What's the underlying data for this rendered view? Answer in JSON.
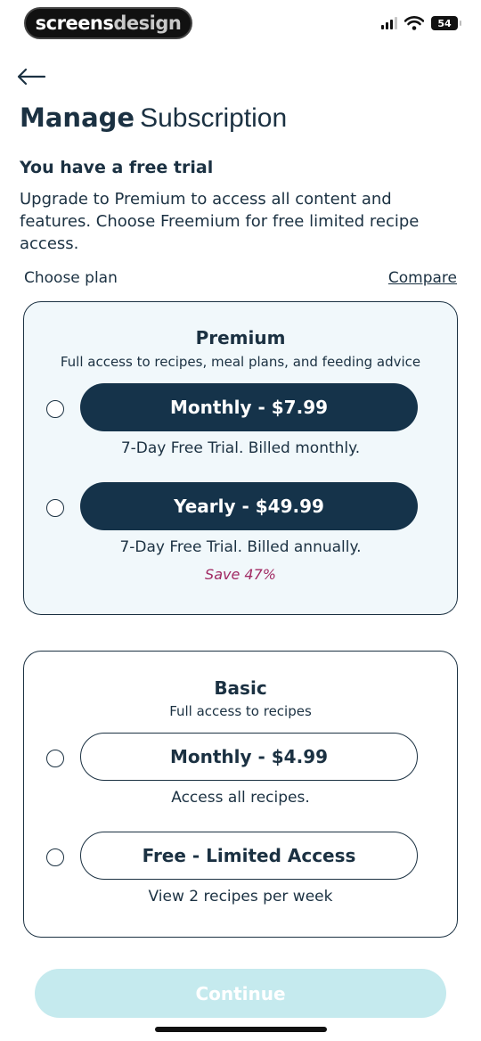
{
  "status_bar": {
    "brand_part1": "screens",
    "brand_part2": "design",
    "battery": "54"
  },
  "header": {
    "back_icon": "arrow-left-icon",
    "title_strong": "Manage",
    "title_light": "Subscription"
  },
  "trial": {
    "heading": "You have a free trial",
    "description": "Upgrade to Premium to access all content and features. Choose Freemium for free limited recipe access."
  },
  "plans_header": {
    "choose_label": "Choose plan",
    "compare_label": "Compare"
  },
  "premium": {
    "title": "Premium",
    "subtitle": "Full access to recipes, meal plans, and feeding advice",
    "options": [
      {
        "label": "Monthly - $7.99",
        "note": "7-Day Free Trial. Billed monthly."
      },
      {
        "label": "Yearly - $49.99",
        "note": "7-Day Free Trial. Billed annually.",
        "save": "Save 47%"
      }
    ]
  },
  "basic": {
    "title": "Basic",
    "subtitle": "Full access to recipes",
    "options": [
      {
        "label": "Monthly - $4.99",
        "note": "Access all recipes."
      },
      {
        "label": "Free - Limited Access",
        "note": "View 2 recipes per week"
      }
    ]
  },
  "footer": {
    "continue_label": "Continue"
  },
  "colors": {
    "primary": "#15334a",
    "premium_bg": "#f1f8fb",
    "save_accent": "#a12a63",
    "continue_disabled": "#c5eaee"
  }
}
